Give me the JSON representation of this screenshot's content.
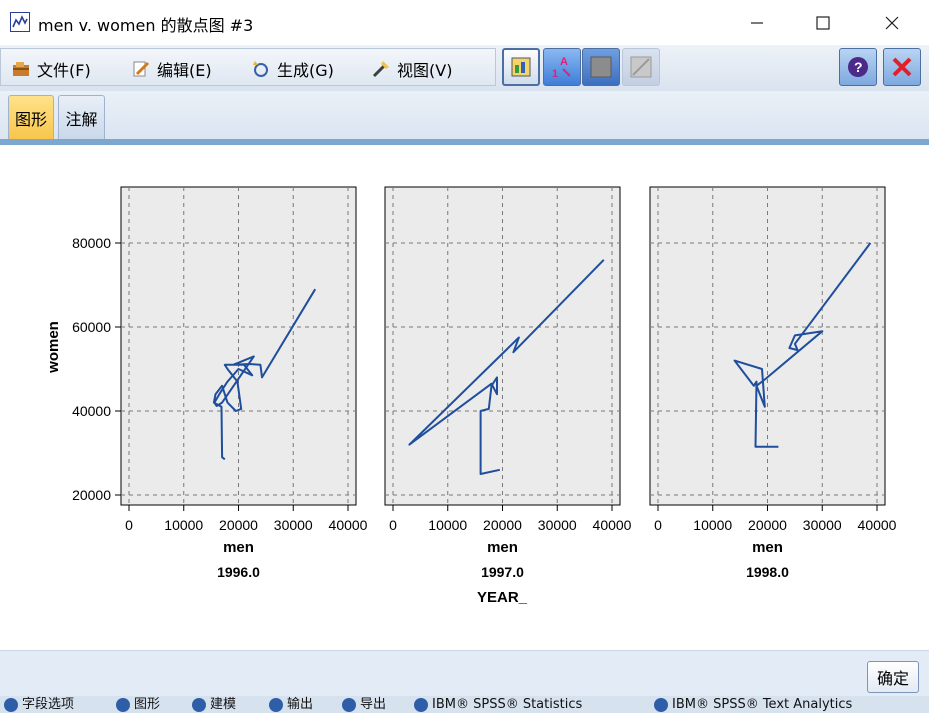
{
  "window": {
    "title": "men v. women 的散点图 #3",
    "minimize_glyph": "—",
    "maximize_glyph": "☐",
    "close_glyph": "✕"
  },
  "menu": {
    "items": [
      {
        "label": "文件(F)",
        "icon": "folder-icon"
      },
      {
        "label": "编辑(E)",
        "icon": "edit-icon"
      },
      {
        "label": "生成(G)",
        "icon": "generate-icon"
      },
      {
        "label": "视图(V)",
        "icon": "view-icon"
      }
    ]
  },
  "tabs": [
    {
      "label": "图形",
      "active": true
    },
    {
      "label": "注解",
      "active": false
    }
  ],
  "footer": {
    "ok_label": "确定"
  },
  "taskbar": {
    "items": [
      "字段选项",
      "图形",
      "建模",
      "输出",
      "导出",
      "IBM® SPSS® Statistics",
      "IBM® SPSS® Text Analytics"
    ]
  },
  "colors": {
    "line": "#1f4e9c",
    "panel_bg": "#ebebeb",
    "tab_active": "#f7c64c",
    "accent": "#7da7cf"
  },
  "chart_data": {
    "type": "line",
    "ylabel": "women",
    "facet_label": "YEAR_",
    "grid": true,
    "xlim": [
      0,
      40000
    ],
    "ylim": [
      17000,
      92000
    ],
    "xticks": [
      0,
      10000,
      20000,
      30000,
      40000
    ],
    "yticks": [
      20000,
      40000,
      60000,
      80000
    ],
    "panels": [
      {
        "xlabel": "men",
        "year": "1996.0",
        "points": [
          [
            17500,
            28500
          ],
          [
            17000,
            29000
          ],
          [
            16900,
            41000
          ],
          [
            15500,
            42000
          ],
          [
            15800,
            44000
          ],
          [
            17000,
            46000
          ],
          [
            18000,
            42000
          ],
          [
            19500,
            40000
          ],
          [
            20500,
            40500
          ],
          [
            19800,
            47000
          ],
          [
            18000,
            50000
          ],
          [
            17500,
            51000
          ],
          [
            21000,
            51000
          ],
          [
            22500,
            48500
          ],
          [
            20000,
            50000
          ],
          [
            18000,
            47000
          ],
          [
            16500,
            44000
          ],
          [
            15600,
            42000
          ],
          [
            16000,
            41200
          ],
          [
            17000,
            42000
          ],
          [
            22800,
            53000
          ],
          [
            20000,
            51500
          ],
          [
            19000,
            51000
          ],
          [
            22000,
            51200
          ],
          [
            24000,
            51000
          ],
          [
            24300,
            48000
          ],
          [
            34000,
            69000
          ]
        ]
      },
      {
        "xlabel": "men",
        "year": "1997.0",
        "points": [
          [
            19500,
            26000
          ],
          [
            16000,
            25000
          ],
          [
            16000,
            40000
          ],
          [
            17500,
            40500
          ],
          [
            18000,
            46000
          ],
          [
            19000,
            48000
          ],
          [
            19000,
            44000
          ],
          [
            18000,
            46500
          ],
          [
            3000,
            32000
          ],
          [
            23000,
            57500
          ],
          [
            22000,
            54000
          ],
          [
            38500,
            76000
          ]
        ]
      },
      {
        "xlabel": "men",
        "year": "1998.0",
        "points": [
          [
            22000,
            31500
          ],
          [
            17800,
            31500
          ],
          [
            18000,
            47000
          ],
          [
            17500,
            46000
          ],
          [
            14000,
            52000
          ],
          [
            19000,
            50000
          ],
          [
            19500,
            41000
          ],
          [
            18000,
            46000
          ],
          [
            19500,
            47500
          ],
          [
            30000,
            59000
          ],
          [
            25000,
            58000
          ],
          [
            24000,
            55000
          ],
          [
            25500,
            54500
          ],
          [
            25000,
            56000
          ],
          [
            38800,
            80000
          ]
        ]
      }
    ]
  }
}
